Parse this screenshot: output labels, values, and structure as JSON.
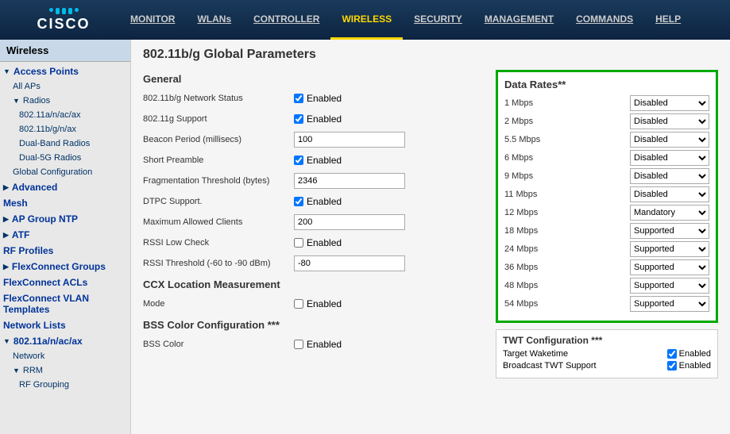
{
  "topbar": {
    "logo_text": "CISCO",
    "nav_items": [
      {
        "label": "MONITOR",
        "active": false
      },
      {
        "label": "WLANs",
        "active": false
      },
      {
        "label": "CONTROLLER",
        "active": false
      },
      {
        "label": "WIRELESS",
        "active": true
      },
      {
        "label": "SECURITY",
        "active": false
      },
      {
        "label": "MANAGEMENT",
        "active": false
      },
      {
        "label": "COMMANDS",
        "active": false
      },
      {
        "label": "HELP",
        "active": false
      }
    ]
  },
  "sidebar": {
    "title": "Wireless",
    "items": [
      {
        "label": "Access Points",
        "level": "parent",
        "expanded": true
      },
      {
        "label": "All APs",
        "level": "child"
      },
      {
        "label": "Radios",
        "level": "child",
        "expanded": true
      },
      {
        "label": "802.11a/n/ac/ax",
        "level": "child2"
      },
      {
        "label": "802.11b/g/n/ax",
        "level": "child2"
      },
      {
        "label": "Dual-Band Radios",
        "level": "child2"
      },
      {
        "label": "Dual-5G Radios",
        "level": "child2"
      },
      {
        "label": "Global Configuration",
        "level": "child"
      },
      {
        "label": "Advanced",
        "level": "parent"
      },
      {
        "label": "Mesh",
        "level": "parent"
      },
      {
        "label": "AP Group NTP",
        "level": "parent"
      },
      {
        "label": "ATF",
        "level": "parent"
      },
      {
        "label": "RF Profiles",
        "level": "parent"
      },
      {
        "label": "FlexConnect Groups",
        "level": "parent"
      },
      {
        "label": "FlexConnect ACLs",
        "level": "parent"
      },
      {
        "label": "FlexConnect VLAN Templates",
        "level": "parent"
      },
      {
        "label": "Network Lists",
        "level": "parent"
      },
      {
        "label": "802.11a/n/ac/ax",
        "level": "parent",
        "expanded": true
      },
      {
        "label": "Network",
        "level": "child"
      },
      {
        "label": "RRM",
        "level": "child"
      },
      {
        "label": "RF Grouping",
        "level": "child2"
      }
    ]
  },
  "page": {
    "title": "802.11b/g Global Parameters"
  },
  "general": {
    "header": "General",
    "fields": [
      {
        "label": "802.11b/g Network Status",
        "type": "checkbox",
        "checked": true,
        "value": "Enabled"
      },
      {
        "label": "802.11g Support",
        "type": "checkbox",
        "checked": true,
        "value": "Enabled"
      },
      {
        "label": "Beacon Period (millisecs)",
        "type": "text",
        "value": "100"
      },
      {
        "label": "Short Preamble",
        "type": "checkbox",
        "checked": true,
        "value": "Enabled"
      },
      {
        "label": "Fragmentation Threshold (bytes)",
        "type": "text",
        "value": "2346"
      },
      {
        "label": "DTPC Support.",
        "type": "checkbox",
        "checked": true,
        "value": "Enabled"
      },
      {
        "label": "Maximum Allowed Clients",
        "type": "text",
        "value": "200"
      },
      {
        "label": "RSSI Low Check",
        "type": "checkbox",
        "checked": false,
        "value": "Enabled"
      },
      {
        "label": "RSSI Threshold (-60 to -90 dBm)",
        "type": "text",
        "value": "-80"
      }
    ]
  },
  "ccx": {
    "header": "CCX Location Measurement",
    "fields": [
      {
        "label": "Mode",
        "type": "checkbox",
        "checked": false,
        "value": "Enabled"
      }
    ]
  },
  "bss": {
    "header": "BSS Color Configuration ***",
    "fields": [
      {
        "label": "BSS Color",
        "type": "checkbox",
        "checked": false,
        "value": "Enabled"
      }
    ]
  },
  "data_rates": {
    "header": "Data Rates**",
    "rates": [
      {
        "label": "1 Mbps",
        "value": "Disabled"
      },
      {
        "label": "2 Mbps",
        "value": "Disabled"
      },
      {
        "label": "5.5 Mbps",
        "value": "Disabled"
      },
      {
        "label": "6 Mbps",
        "value": "Disabled"
      },
      {
        "label": "9 Mbps",
        "value": "Disabled"
      },
      {
        "label": "11 Mbps",
        "value": "Disabled"
      },
      {
        "label": "12 Mbps",
        "value": "Mandatory"
      },
      {
        "label": "18 Mbps",
        "value": "Supported"
      },
      {
        "label": "24 Mbps",
        "value": "Supported"
      },
      {
        "label": "36 Mbps",
        "value": "Supported"
      },
      {
        "label": "48 Mbps",
        "value": "Supported"
      },
      {
        "label": "54 Mbps",
        "value": "Supported"
      }
    ],
    "options": [
      "Disabled",
      "Mandatory",
      "Supported"
    ]
  },
  "twt": {
    "header": "TWT Configuration ***",
    "fields": [
      {
        "label": "Target Waketime",
        "type": "checkbox",
        "checked": true,
        "value": "Enabled"
      },
      {
        "label": "Broadcast TWT Support",
        "type": "checkbox",
        "checked": true,
        "value": "Enabled"
      }
    ]
  }
}
